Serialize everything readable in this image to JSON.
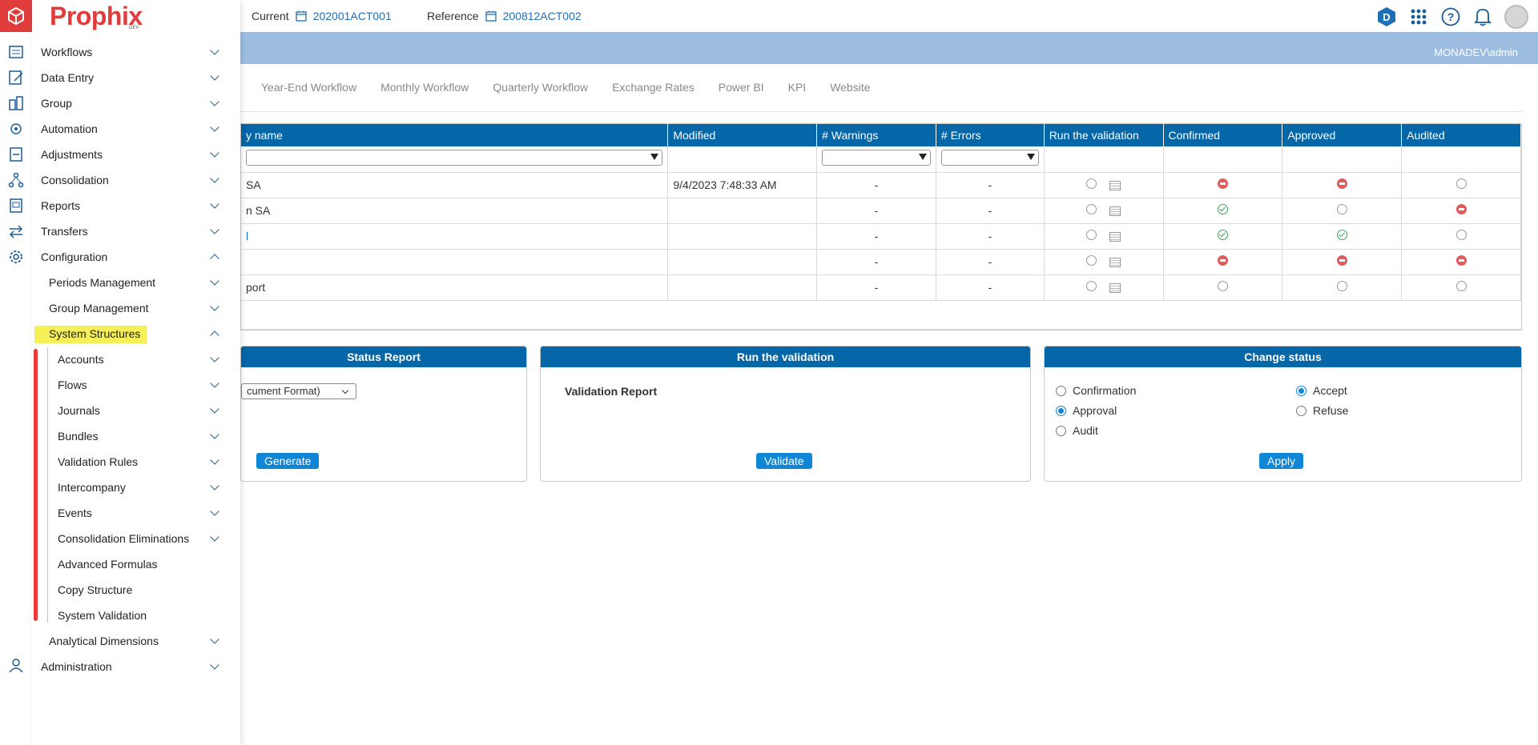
{
  "topbar": {
    "current_label": "Current",
    "current_value": "202001ACT001",
    "reference_label": "Reference",
    "reference_value": "200812ACT002",
    "badge_letter": "D",
    "user": "MONADEV\\admin"
  },
  "brand": {
    "name": "Prophix",
    "sub": "DEV"
  },
  "tabs": [
    "Year-End Workflow",
    "Monthly Workflow",
    "Quarterly Workflow",
    "Exchange Rates",
    "Power BI",
    "KPI",
    "Website"
  ],
  "table": {
    "headers": [
      "y name",
      "Modified",
      "# Warnings",
      "# Errors",
      "Run the validation",
      "Confirmed",
      "Approved",
      "Audited"
    ],
    "rows": [
      {
        "name": "SA",
        "modified": "9/4/2023 7:48:33 AM",
        "warnings": "-",
        "errors": "-"
      },
      {
        "name": "n SA",
        "modified": "",
        "warnings": "-",
        "errors": "-"
      },
      {
        "name": "l",
        "modified": "",
        "warnings": "-",
        "errors": "-"
      },
      {
        "name": "",
        "modified": "",
        "warnings": "-",
        "errors": "-"
      },
      {
        "name": "port",
        "modified": "",
        "warnings": "-",
        "errors": "-"
      }
    ]
  },
  "panels": {
    "status_report": {
      "title": "Status Report",
      "select_value": "cument Format)",
      "button": "Generate"
    },
    "run_validation": {
      "title": "Run the validation",
      "label": "Validation Report",
      "button": "Validate"
    },
    "change_status": {
      "title": "Change status",
      "options_left": [
        "Confirmation",
        "Approval",
        "Audit"
      ],
      "options_right": [
        "Accept",
        "Refuse"
      ],
      "button": "Apply"
    }
  },
  "menu": {
    "items": [
      "Workflows",
      "Data Entry",
      "Group",
      "Automation",
      "Adjustments",
      "Consolidation",
      "Reports",
      "Transfers",
      "Configuration"
    ],
    "config_children": [
      "Periods Management",
      "Group Management",
      "System Structures"
    ],
    "structure_children": [
      "Accounts",
      "Flows",
      "Journals",
      "Bundles",
      "Validation Rules",
      "Intercompany",
      "Events",
      "Consolidation Eliminations",
      "Advanced Formulas",
      "Copy Structure",
      "System Validation"
    ],
    "after": [
      "Analytical Dimensions",
      "Administration"
    ]
  },
  "colors": {
    "brand_red": "#e03c3c",
    "header_blue": "#0566a8",
    "button_blue": "#0f86d6",
    "highlight_yellow": "#f5ef58"
  }
}
